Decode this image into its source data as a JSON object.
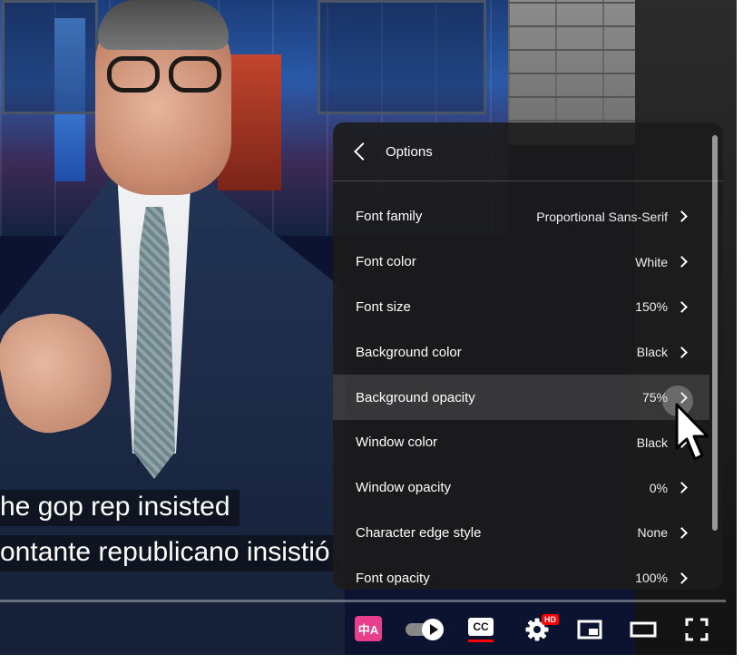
{
  "captions": {
    "line1": "he gop rep insisted",
    "line2": "ontante republicano insistió"
  },
  "settings_panel": {
    "title": "Options",
    "rows": [
      {
        "label": "Font family",
        "value": "Proportional Sans-Serif"
      },
      {
        "label": "Font color",
        "value": "White"
      },
      {
        "label": "Font size",
        "value": "150%"
      },
      {
        "label": "Background color",
        "value": "Black"
      },
      {
        "label": "Background opacity",
        "value": "75%"
      },
      {
        "label": "Window color",
        "value": "Black"
      },
      {
        "label": "Window opacity",
        "value": "0%"
      },
      {
        "label": "Character edge style",
        "value": "None"
      },
      {
        "label": "Font opacity",
        "value": "100%"
      }
    ]
  },
  "controls": {
    "translate_glyph": "中A",
    "cc_label": "CC",
    "hd_badge": "HD"
  },
  "icons": [
    "back-icon",
    "chevron-right-icon",
    "translate-icon",
    "autoplay-toggle-icon",
    "cc-icon",
    "gear-icon",
    "miniplayer-icon",
    "theater-mode-icon",
    "fullscreen-icon",
    "mouse-cursor-icon"
  ],
  "colors": {
    "panel_bg": "#1c1c1c",
    "accent_red": "#ff0000",
    "translate_pink": "#e83e8c"
  }
}
